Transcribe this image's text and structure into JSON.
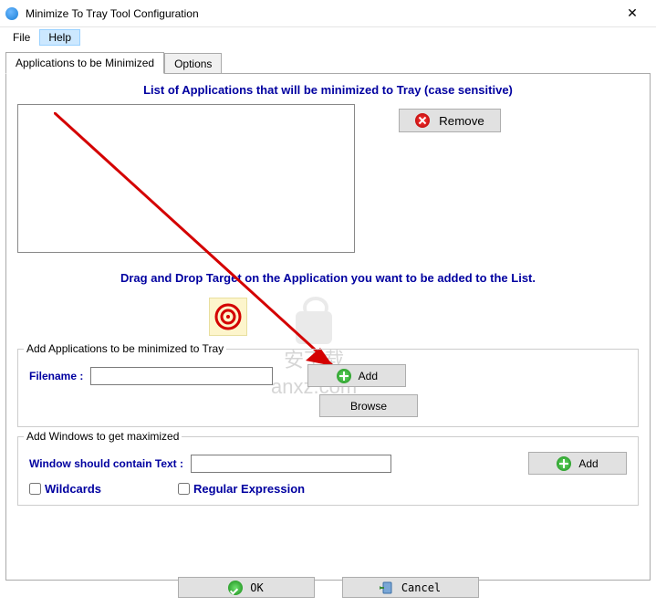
{
  "title": "Minimize To Tray Tool Configuration",
  "menu": {
    "file": "File",
    "help": "Help"
  },
  "tabs": {
    "apps": "Applications to be Minimized",
    "options": "Options"
  },
  "list_title": "List of Applications that will be minimized to Tray (case sensitive)",
  "remove_label": "Remove",
  "drag_hint": "Drag and Drop Target on the Application you want to be added to the List.",
  "group_add_app": {
    "legend": "Add Applications to be minimized to Tray",
    "filename_label": "Filename :",
    "filename_value": "",
    "add_label": "Add",
    "browse_label": "Browse"
  },
  "group_add_win": {
    "legend": "Add Windows to get maximized",
    "text_label": "Window should contain Text :",
    "text_value": "",
    "add_label": "Add",
    "wildcards_label": "Wildcards",
    "regex_label": "Regular Expression"
  },
  "buttons": {
    "ok": "OK",
    "cancel": "Cancel"
  },
  "watermark": {
    "line1": "安下载",
    "line2": "anxz.com"
  }
}
